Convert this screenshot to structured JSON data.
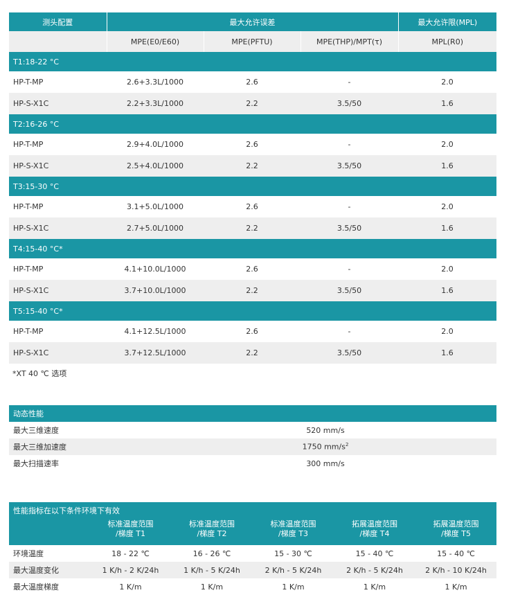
{
  "accuracy": {
    "header": {
      "probe_config": "测头配置",
      "max_error": "最大允许误差",
      "max_limit": "最大允许限(MPL)"
    },
    "subheader": [
      "MPE(E0/E60)",
      "MPE(PFTU)",
      "MPE(THP)/MPT(τ)",
      "MPL(R0)"
    ],
    "groups": [
      {
        "label": "T1:18-22 °C",
        "rows": [
          [
            "HP-T-MP",
            "2.6+3.3L/1000",
            "2.6",
            "-",
            "2.0"
          ],
          [
            "HP-S-X1C",
            "2.2+3.3L/1000",
            "2.2",
            "3.5/50",
            "1.6"
          ]
        ]
      },
      {
        "label": "T2:16-26 °C",
        "rows": [
          [
            "HP-T-MP",
            "2.9+4.0L/1000",
            "2.6",
            "-",
            "2.0"
          ],
          [
            "HP-S-X1C",
            "2.5+4.0L/1000",
            "2.2",
            "3.5/50",
            "1.6"
          ]
        ]
      },
      {
        "label": "T3:15-30 °C",
        "rows": [
          [
            "HP-T-MP",
            "3.1+5.0L/1000",
            "2.6",
            "-",
            "2.0"
          ],
          [
            "HP-S-X1C",
            "2.7+5.0L/1000",
            "2.2",
            "3.5/50",
            "1.6"
          ]
        ]
      },
      {
        "label": "T4:15-40 °C*",
        "rows": [
          [
            "HP-T-MP",
            "4.1+10.0L/1000",
            "2.6",
            "-",
            "2.0"
          ],
          [
            "HP-S-X1C",
            "3.7+10.0L/1000",
            "2.2",
            "3.5/50",
            "1.6"
          ]
        ]
      },
      {
        "label": "T5:15-40 °C*",
        "rows": [
          [
            "HP-T-MP",
            "4.1+12.5L/1000",
            "2.6",
            "-",
            "2.0"
          ],
          [
            "HP-S-X1C",
            "3.7+12.5L/1000",
            "2.2",
            "3.5/50",
            "1.6"
          ]
        ]
      }
    ],
    "note": "*XT 40 ℃ 选项"
  },
  "dynamic": {
    "title": "动态性能",
    "rows": [
      {
        "label": "最大三维速度",
        "value": "520 mm/s",
        "sup": ""
      },
      {
        "label": "最大三维加速度",
        "value": "1750 mm/s",
        "sup": "2"
      },
      {
        "label": "最大扫描速率",
        "value": "300 mm/s",
        "sup": ""
      }
    ]
  },
  "conditions": {
    "title": "性能指标在以下条件环境下有效",
    "columns": [
      [
        "标准温度范围",
        "/梯度 T1"
      ],
      [
        "标准温度范围",
        "/梯度 T2"
      ],
      [
        "标准温度范围",
        "/梯度 T3"
      ],
      [
        "拓展温度范围",
        "/梯度 T4"
      ],
      [
        "拓展温度范围",
        "/梯度 T5"
      ]
    ],
    "rows": [
      [
        "环境温度",
        "18 - 22 ℃",
        "16 - 26 ℃",
        "15 - 30 ℃",
        "15 - 40 ℃",
        "15 - 40 ℃"
      ],
      [
        "最大温度变化",
        "1 K/h - 2 K/24h",
        "1 K/h - 5 K/24h",
        "2 K/h - 5 K/24h",
        "2 K/h - 5 K/24h",
        "2 K/h - 10 K/24h"
      ],
      [
        "最大温度梯度",
        "1 K/m",
        "1 K/m",
        "1 K/m",
        "1 K/m",
        "1 K/m"
      ]
    ]
  }
}
